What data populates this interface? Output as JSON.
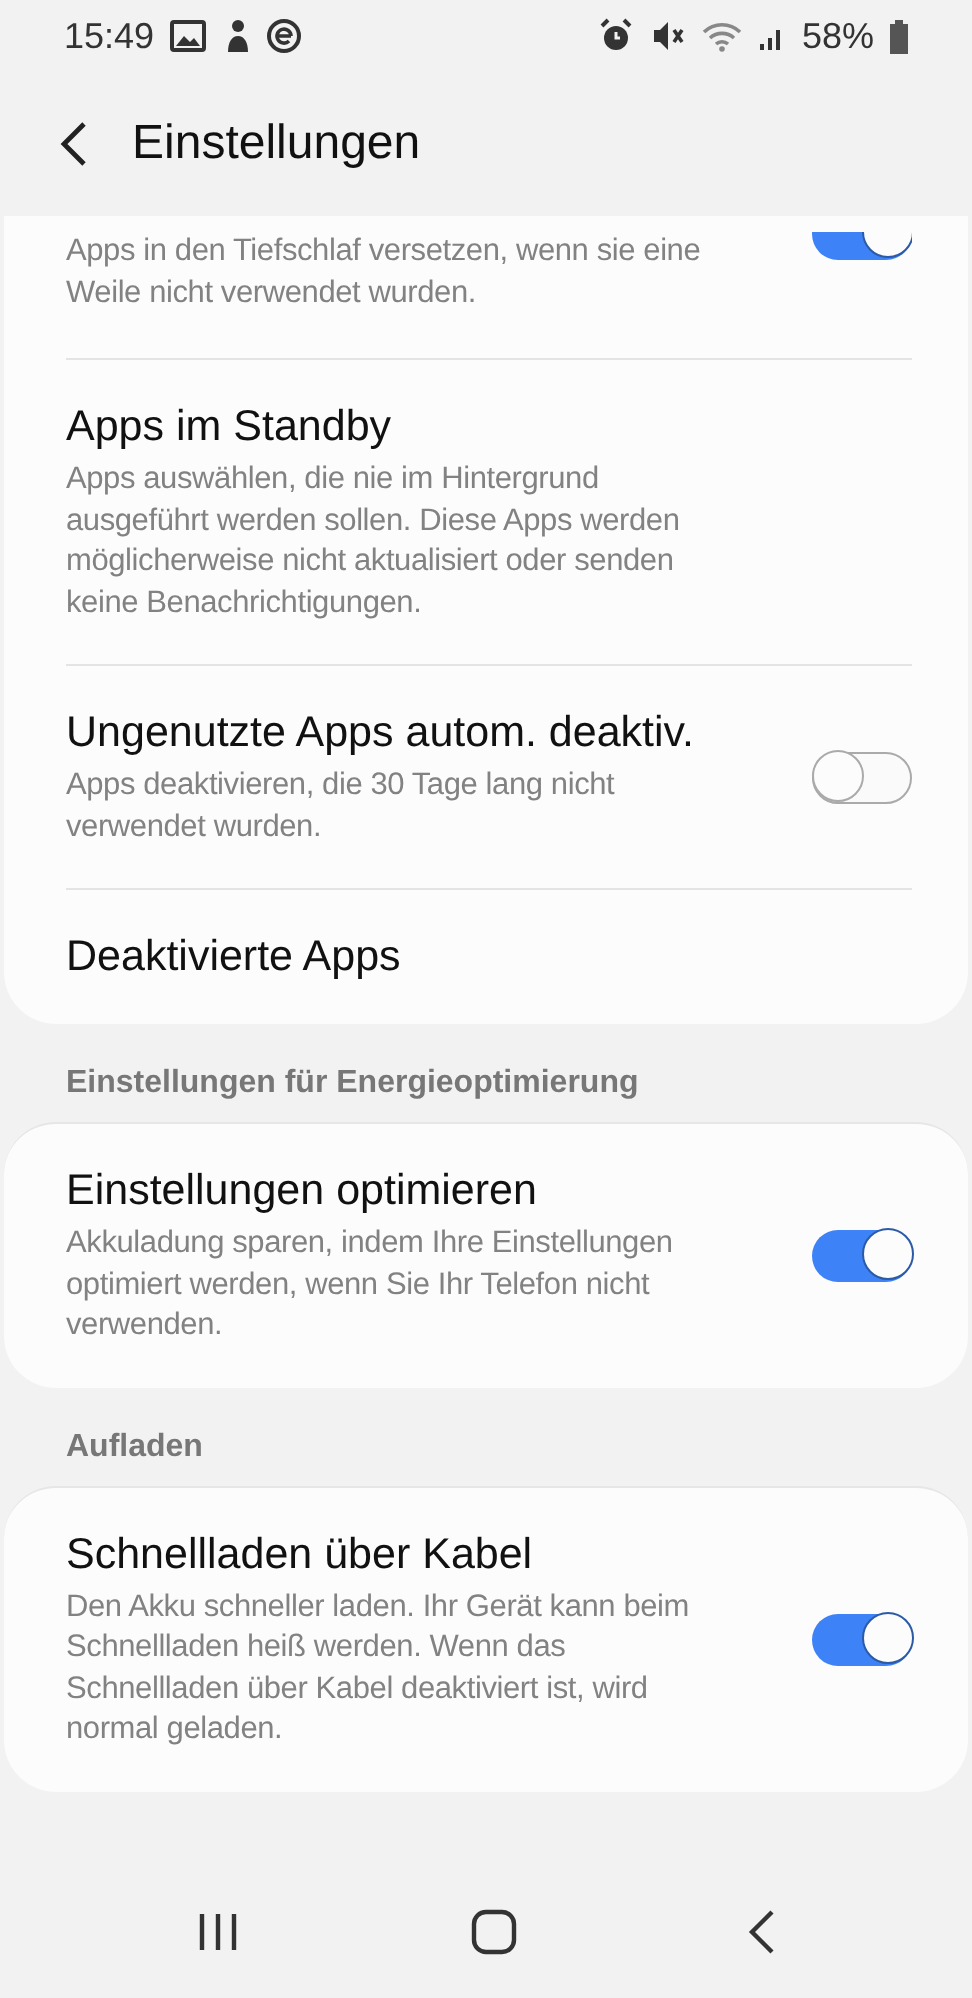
{
  "status_bar": {
    "time": "15:49",
    "battery": "58%"
  },
  "header": {
    "title": "Einstellungen"
  },
  "sections": [
    {
      "items": [
        {
          "description": "Apps in den Tiefschlaf versetzen, wenn sie eine Weile nicht verwendet wurden.",
          "on": true,
          "cut": true
        },
        {
          "title": "Apps im Standby",
          "description": "Apps auswählen, die nie im Hintergrund ausgeführt werden sollen. Diese Apps werden möglicherweise nicht aktualisiert oder senden keine Benachrichtigungen."
        },
        {
          "title": "Ungenutzte Apps autom. deaktiv.",
          "description": "Apps deaktivieren, die 30 Tage lang nicht verwendet wurden.",
          "on": false
        },
        {
          "title": "Deaktivierte Apps"
        }
      ]
    },
    {
      "heading": "Einstellungen für Energieoptimierung",
      "items": [
        {
          "title": "Einstellungen optimieren",
          "description": "Akkuladung sparen, indem Ihre Einstellungen optimiert werden, wenn Sie Ihr Telefon nicht verwenden.",
          "on": true
        }
      ]
    },
    {
      "heading": "Aufladen",
      "items": [
        {
          "title": "Schnellladen über Kabel",
          "description": "Den Akku schneller laden. Ihr Gerät kann beim Schnellladen heiß werden. Wenn das Schnellladen über Kabel deaktiviert ist, wird normal geladen.",
          "on": true
        }
      ]
    }
  ]
}
